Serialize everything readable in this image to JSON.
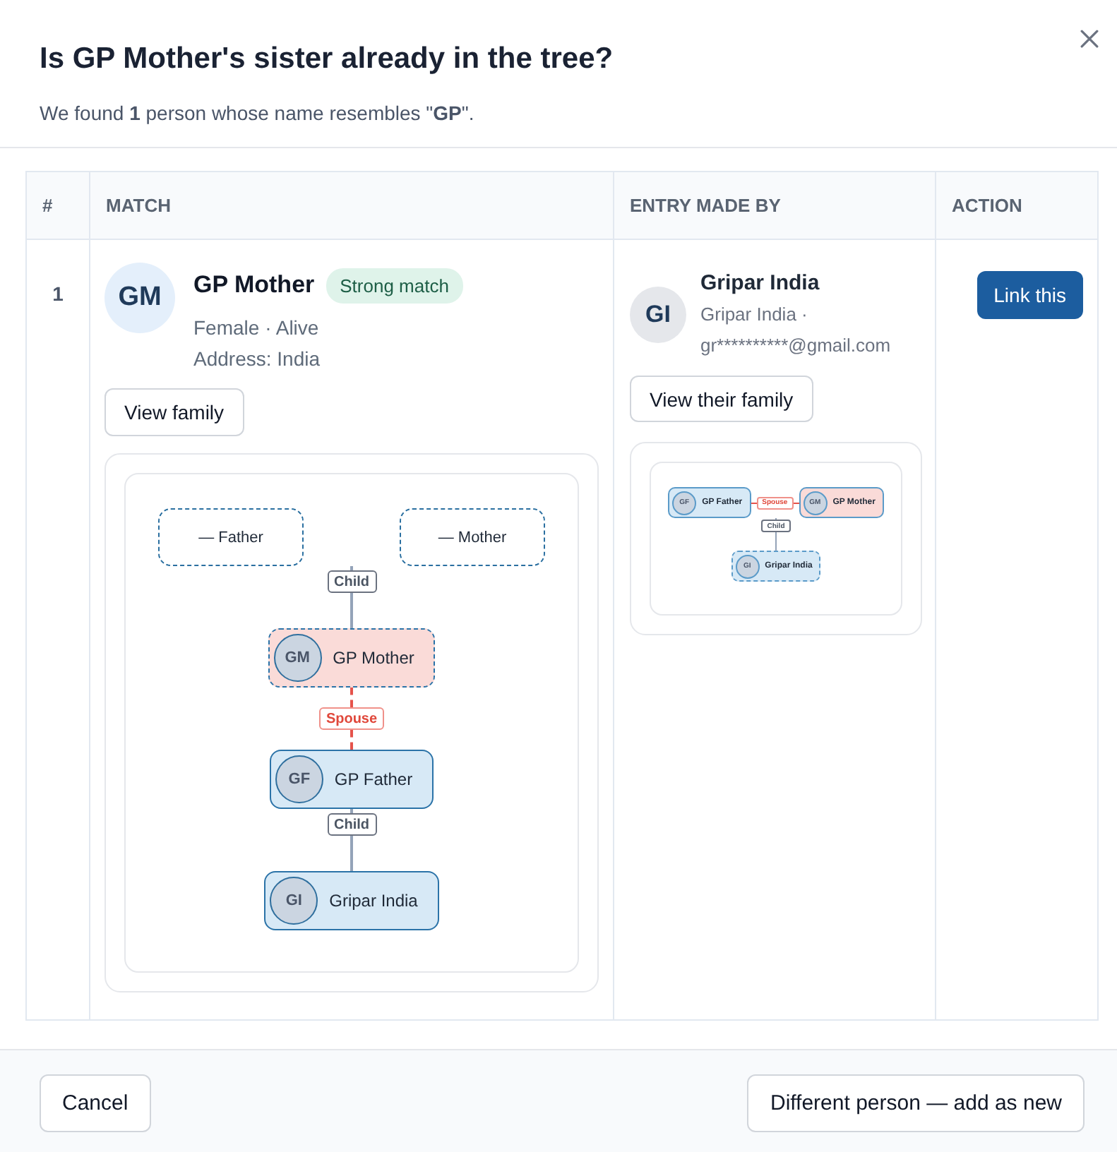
{
  "dialog": {
    "title": "Is GP Mother's sister already in the tree?",
    "subtitle": "We found **1** person whose name resembles \"**GP**\"."
  },
  "table": {
    "columns": [
      "#",
      "MATCH",
      "ENTRY MADE BY",
      "ACTION"
    ],
    "rows": [
      {
        "number": "1",
        "match": {
          "initials": "GM",
          "name": "GP Mother",
          "badge": "Strong match",
          "details": [
            "Female · Alive",
            "Address: India"
          ],
          "button": "View family",
          "tree": {
            "rows": [
              [
                {
                  "kind": "placeholder",
                  "label": "— Father"
                },
                {
                  "kind": "placeholder",
                  "label": "— Mother"
                }
              ],
              [
                {
                  "kind": "child_link",
                  "label": "Child"
                }
              ],
              [
                {
                  "kind": "person",
                  "initials": "GM",
                  "name": "GP Mother",
                  "color": "#fadbd8",
                  "highlighted": true
                }
              ],
              [
                {
                  "kind": "spouse_link",
                  "label": "Spouse"
                }
              ],
              [
                {
                  "kind": "person",
                  "initials": "GF",
                  "name": "GP Father",
                  "color": "#d7e9f6",
                  "highlighted": false
                }
              ],
              [
                {
                  "kind": "child_link",
                  "label": "Child"
                }
              ],
              [
                {
                  "kind": "person",
                  "initials": "GI",
                  "name": "Gripar India",
                  "color": "#d7e9f6",
                  "highlighted": false
                }
              ]
            ]
          }
        },
        "entry_made_by": {
          "initials": "GI",
          "name": "Gripar India",
          "detail": "Gripar India · gr**********@gmail.com",
          "button": "View their family",
          "tree": {
            "rows": [
              [
                {
                  "kind": "person",
                  "initials": "GF",
                  "name": "GP Father",
                  "color": "#d7e9f6",
                  "highlighted": false
                },
                {
                  "kind": "spouse_link",
                  "label": "Spouse"
                },
                {
                  "kind": "person",
                  "initials": "GM",
                  "name": "GP Mother",
                  "color": "#fadbd8",
                  "highlighted": false
                }
              ],
              [
                {
                  "kind": "child_link",
                  "label": "Child"
                }
              ],
              [
                {
                  "kind": "person",
                  "initials": "GI",
                  "name": "Gripar India",
                  "color": "#d7e9f6",
                  "highlighted": true
                }
              ]
            ]
          }
        },
        "action": {
          "button": "Link this"
        }
      }
    ]
  },
  "footer": {
    "buttons": [
      "Cancel",
      "Different person — add as new"
    ]
  }
}
